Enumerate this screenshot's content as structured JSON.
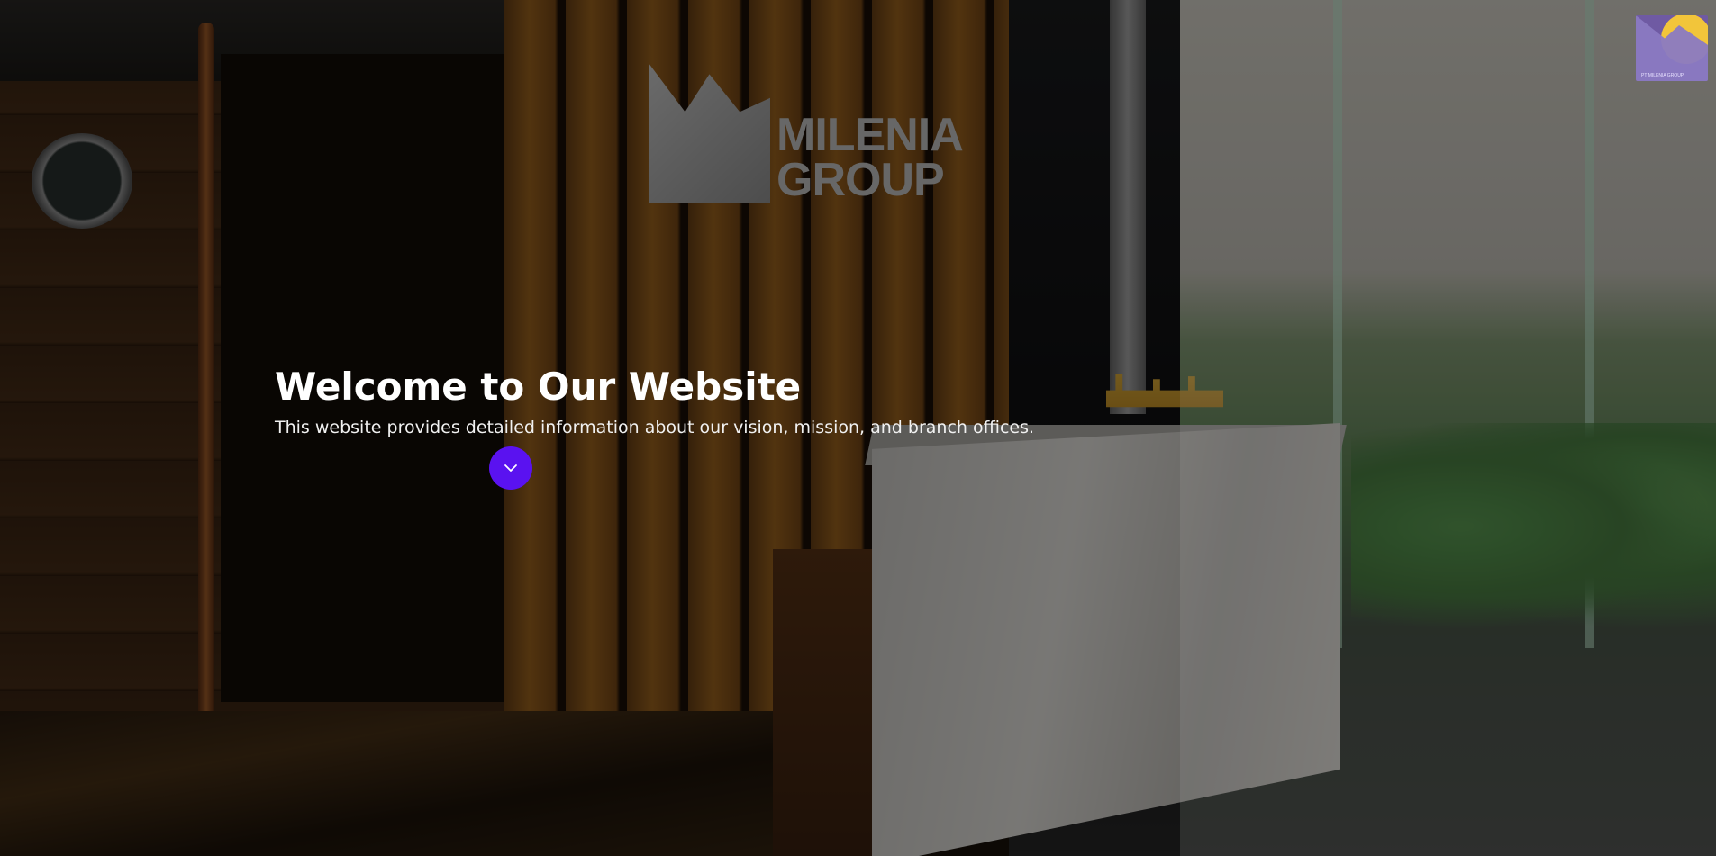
{
  "hero": {
    "title": "Welcome to Our Website",
    "subtitle": "This website provides detailed information about our vision, mission, and branch offices.",
    "scroll_button": {
      "icon": "chevron-down-icon",
      "color": "#5a12f0"
    }
  },
  "background": {
    "signage_text_line1": "MILENIA",
    "signage_text_line2": "GROUP"
  },
  "corner_logo": {
    "caption": "PT MILENIA GROUP"
  },
  "colors": {
    "accent": "#5a12f0",
    "logo_purple": "#6f5aa3",
    "logo_sun": "#f2c53a"
  }
}
